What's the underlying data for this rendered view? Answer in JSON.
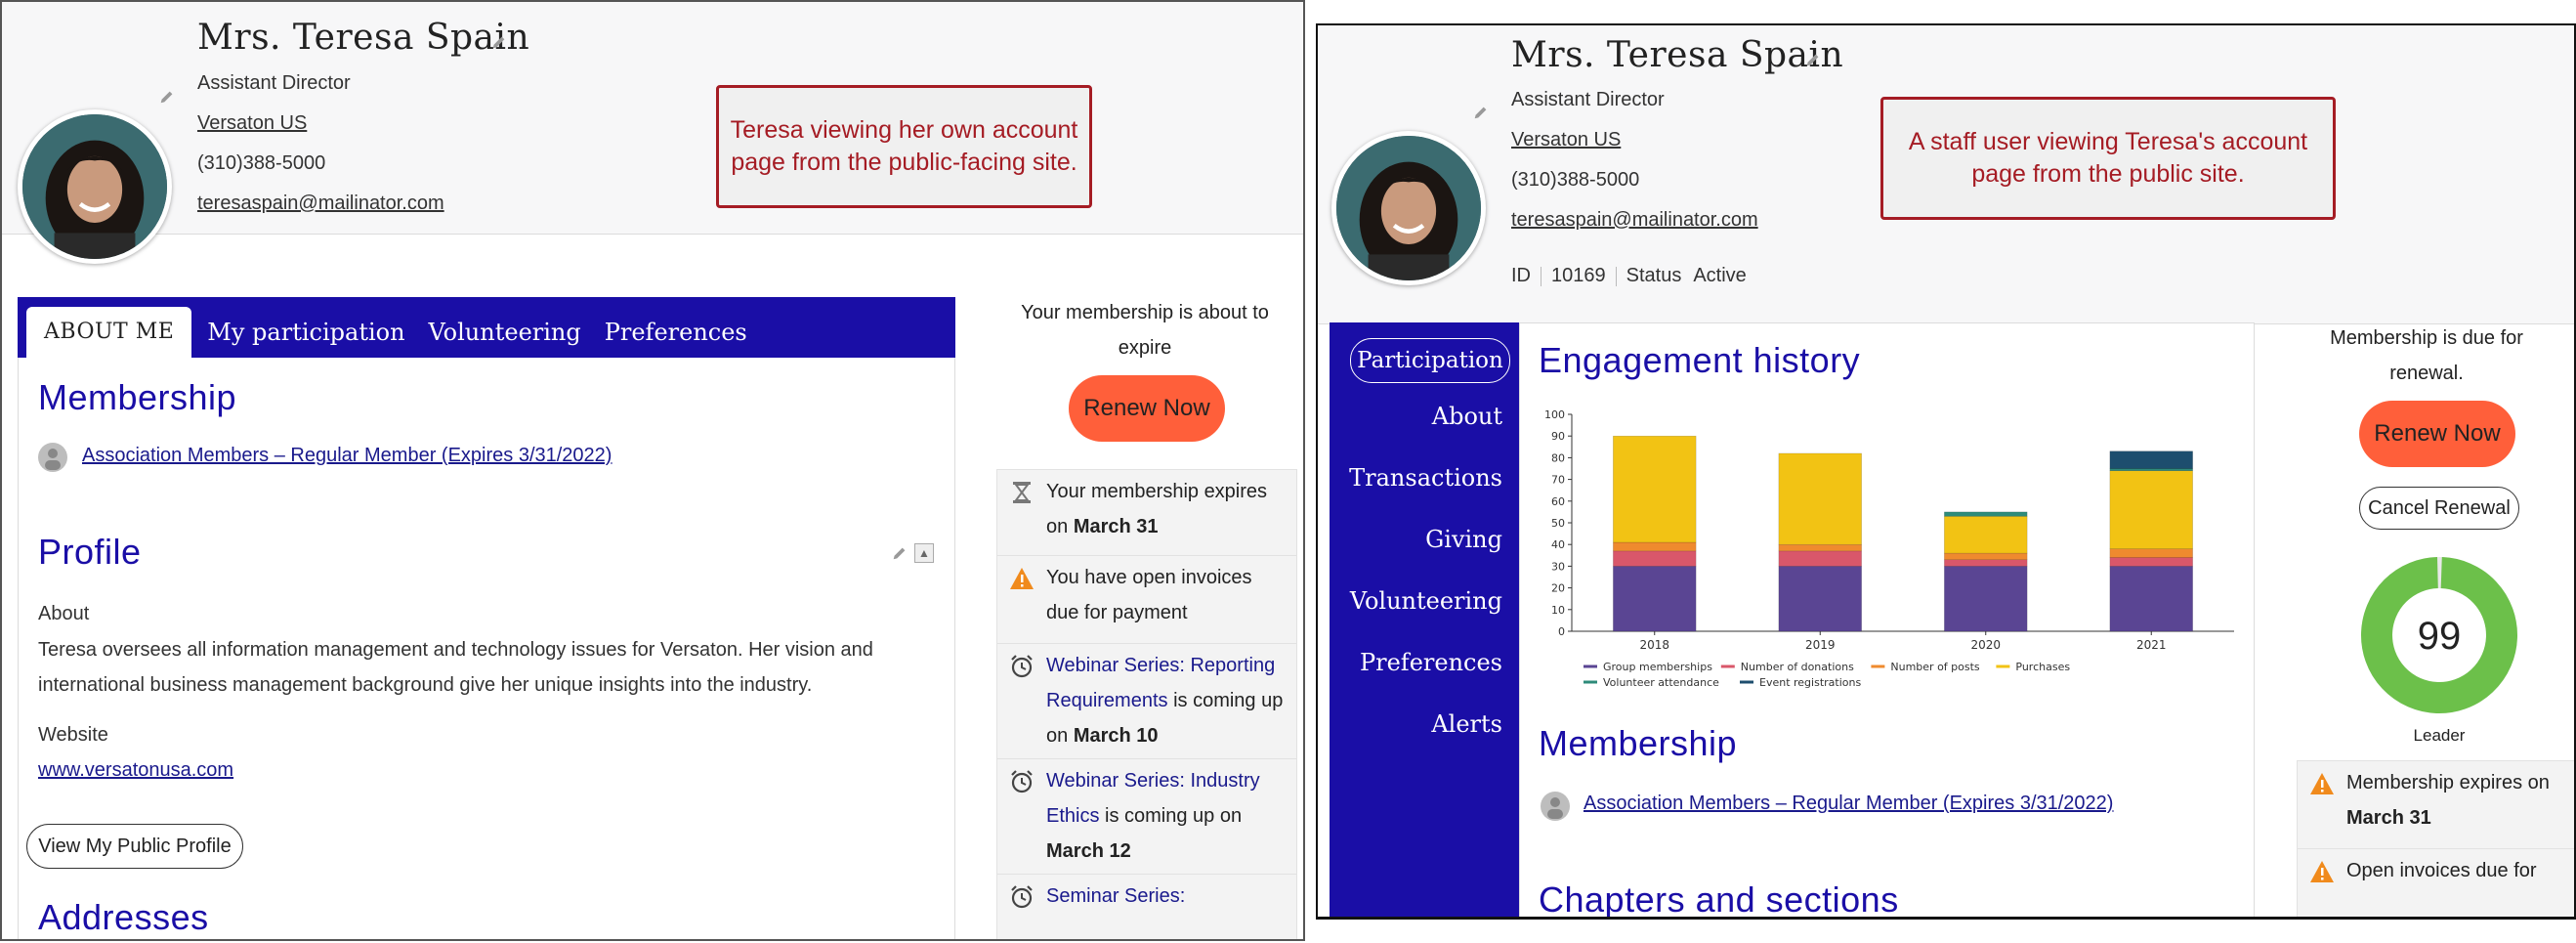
{
  "left": {
    "profile": {
      "name": "Mrs. Teresa Spain",
      "title": "Assistant Director",
      "organization": "Versaton US",
      "phone": "(310)388-5000",
      "email": "teresaspain@mailinator.com"
    },
    "callout": "Teresa viewing her own account page from the public-facing site.",
    "tabs": [
      "ABOUT ME",
      "My participation",
      "Volunteering",
      "Preferences"
    ],
    "membership": {
      "heading": "Membership",
      "link": "Association Members – Regular Member (Expires 3/31/2022)"
    },
    "profile_section": {
      "heading": "Profile",
      "about_label": "About",
      "about_text_line1": "Teresa oversees all information management and technology issues for Versaton. Her vision and",
      "about_text_line2": "international business management background give her unique insights into the industry.",
      "website_label": "Website",
      "website": "www.versatonusa.com",
      "public_profile_button": "View My Public Profile"
    },
    "addresses_heading": "Addresses",
    "sidebar": {
      "membership_notice": "Your membership is about to expire",
      "renew_button": "Renew Now",
      "alerts": [
        {
          "icon": "hourglass-icon",
          "text": "Your membership expires on",
          "bold": "March 31"
        },
        {
          "icon": "warning-icon",
          "text": "You have open invoices due for payment"
        },
        {
          "icon": "alarm-clock-icon",
          "link": "Webinar Series: Reporting Requirements",
          "text": " is coming up on ",
          "bold": "March 10"
        },
        {
          "icon": "alarm-clock-icon",
          "link": "Webinar Series: Industry Ethics",
          "text": " is coming up on ",
          "bold": "March 12"
        },
        {
          "icon": "alarm-clock-icon",
          "link": "Seminar Series:"
        }
      ]
    }
  },
  "right": {
    "profile": {
      "name": "Mrs. Teresa Spain",
      "title": "Assistant Director",
      "organization": "Versaton US",
      "phone": "(310)388-5000",
      "email": "teresaspain@mailinator.com",
      "id_label": "ID",
      "id_value": "10169",
      "status_label": "Status",
      "status_value": "Active"
    },
    "callout": "A staff user viewing Teresa's account page from the public site.",
    "nav": [
      "Participation",
      "About",
      "Transactions",
      "Giving",
      "Volunteering",
      "Preferences",
      "Alerts"
    ],
    "engagement_heading": "Engagement history",
    "membership": {
      "heading": "Membership",
      "link": "Association Members – Regular Member (Expires 3/31/2022)"
    },
    "chapters_heading": "Chapters and sections",
    "sidebar": {
      "membership_notice": "Membership is due for renewal.",
      "renew_button": "Renew Now",
      "cancel_button": "Cancel Renewal",
      "score": "99",
      "score_fraction": 0.99,
      "score_label": "Leader",
      "alerts": [
        {
          "icon": "warning-icon",
          "text": "Membership expires on",
          "bold": "March 31"
        },
        {
          "icon": "warning-icon",
          "text": "Open invoices due for"
        }
      ]
    }
  },
  "colors": {
    "brand_blue": "#1a0ea6",
    "renew": "#ff5f3a",
    "callout": "#a51c24",
    "score_green": "#6cc04a"
  },
  "chart_data": {
    "type": "bar",
    "stacked": true,
    "categories": [
      "2018",
      "2019",
      "2020",
      "2021"
    ],
    "ylim": [
      0,
      100
    ],
    "yticks": [
      0,
      10,
      20,
      30,
      40,
      50,
      60,
      70,
      80,
      90,
      100
    ],
    "legend_position": "bottom",
    "series": [
      {
        "name": "Group memberships",
        "color": "#5a4593",
        "values": [
          30,
          30,
          30,
          30
        ]
      },
      {
        "name": "Number of donations",
        "color": "#d9576a",
        "values": [
          7,
          7,
          3,
          4
        ]
      },
      {
        "name": "Number of posts",
        "color": "#ef8a2e",
        "values": [
          4,
          3,
          3,
          4
        ]
      },
      {
        "name": "Purchases",
        "color": "#f2c314",
        "values": [
          49,
          42,
          17,
          36
        ]
      },
      {
        "name": "Volunteer attendance",
        "color": "#2e8b7a",
        "values": [
          0,
          0,
          2,
          1
        ]
      },
      {
        "name": "Event registrations",
        "color": "#1d4e6e",
        "values": [
          0,
          0,
          0,
          8
        ]
      }
    ]
  }
}
